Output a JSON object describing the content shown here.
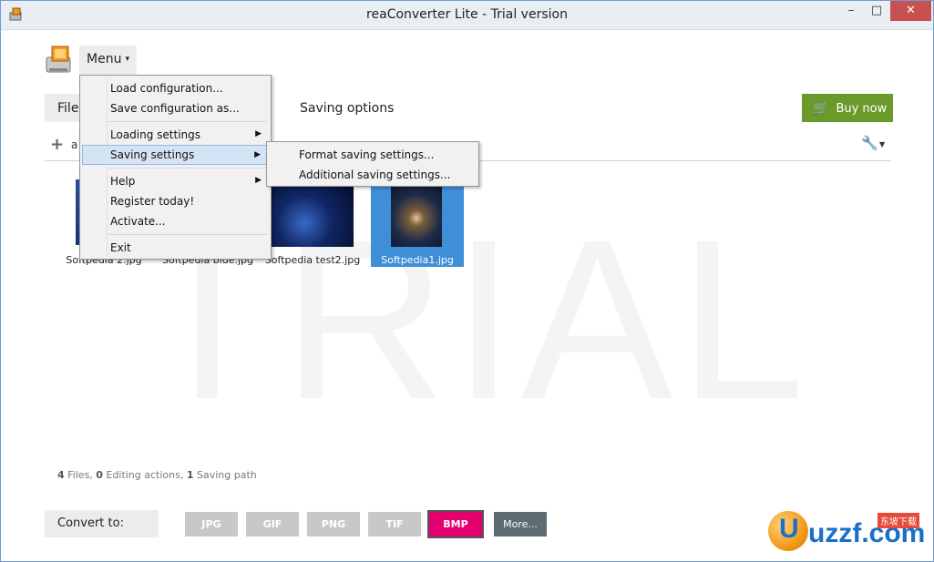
{
  "window": {
    "title": "reaConverter Lite - Trial version",
    "controls": {
      "minimize": "–",
      "maximize": "□",
      "close": "✕"
    }
  },
  "watermark": "TRIAL",
  "menu_button": {
    "label": "Menu",
    "caret": "▾"
  },
  "tabs": {
    "files": "Files",
    "saving": "Saving options"
  },
  "buy_button": {
    "label": "Buy now",
    "icon": "cart-icon"
  },
  "toolbar": {
    "add_label": "a",
    "wrench_icon": "wrench-icon"
  },
  "thumbnails": [
    {
      "caption": "Softpedia 2.jpg",
      "selected": false
    },
    {
      "caption": "Softpedia blue.jpg",
      "selected": false
    },
    {
      "caption": "Softpedia test2.jpg",
      "selected": false
    },
    {
      "caption": "Softpedia1.jpg",
      "selected": true
    }
  ],
  "status": {
    "files_count": "4",
    "files_label": "Files,",
    "editing_count": "0",
    "editing_label": "Editing actions,",
    "saving_count": "1",
    "saving_label": "Saving path"
  },
  "convert": {
    "label": "Convert to:",
    "formats": [
      "JPG",
      "GIF",
      "PNG",
      "TIF",
      "BMP"
    ],
    "selected": "BMP",
    "more": "More..."
  },
  "main_menu": {
    "items": [
      {
        "label": "Load configuration...",
        "submenu": false
      },
      {
        "label": "Save configuration as...",
        "submenu": false
      },
      {
        "label": "Loading settings",
        "submenu": true
      },
      {
        "label": "Saving settings",
        "submenu": true,
        "highlighted": true
      },
      {
        "label": "Help",
        "submenu": true
      },
      {
        "label": "Register today!",
        "submenu": false
      },
      {
        "label": "Activate...",
        "submenu": false
      },
      {
        "label": "Exit",
        "submenu": false
      }
    ]
  },
  "saving_submenu": {
    "items": [
      "Format saving settings...",
      "Additional saving settings..."
    ]
  },
  "brand": {
    "word": "uzzf.com",
    "tagline": "东坡下载",
    "letter": "U"
  },
  "colors": {
    "accent_green": "#6a9a2a",
    "selected_format": "#e2006f",
    "format_inactive": "#c8c8c8",
    "more_button": "#5d6b73",
    "selection_blue": "#3f8fd8",
    "menu_highlight": "#d5e4f5"
  }
}
